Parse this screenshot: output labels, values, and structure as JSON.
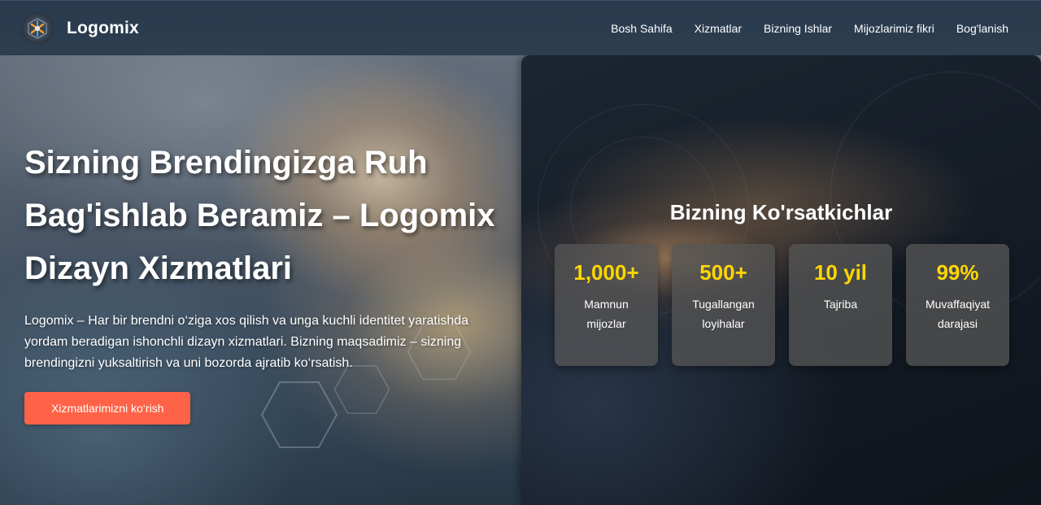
{
  "brand": {
    "name": "Logomix",
    "logo_icon": "logo-emblem-icon"
  },
  "nav": {
    "items": [
      {
        "label": "Bosh Sahifa"
      },
      {
        "label": "Xizmatlar"
      },
      {
        "label": "Bizning Ishlar"
      },
      {
        "label": "Mijozlarimiz fikri"
      },
      {
        "label": "Bog'lanish"
      }
    ]
  },
  "hero": {
    "title": "Sizning Brendingizga Ruh Bag'ishlab Beramiz – Logomix Dizayn Xizmatlari",
    "description": "Logomix – Har bir brendni o‘ziga xos qilish va unga kuchli identitet yaratishda yordam beradigan ishonchli dizayn xizmatlari. Bizning maqsadimiz – sizning brendingizni yuksaltirish va uni bozorda ajratib ko‘rsatish.",
    "cta_label": "Xizmatlarimizni ko‘rish"
  },
  "stats": {
    "title": "Bizning Ko'rsatkichlar",
    "items": [
      {
        "value": "1,000+",
        "label": "Mamnun mijozlar"
      },
      {
        "value": "500+",
        "label": "Tugallangan loyihalar"
      },
      {
        "value": "10 yil",
        "label": "Tajriba"
      },
      {
        "value": "99%",
        "label": "Muvaffaqiyat darajasi"
      }
    ]
  },
  "colors": {
    "nav_bg": "#2c3e50",
    "cta": "#ff6347",
    "stat_value": "#ffd700",
    "stat_card": "#555555"
  }
}
